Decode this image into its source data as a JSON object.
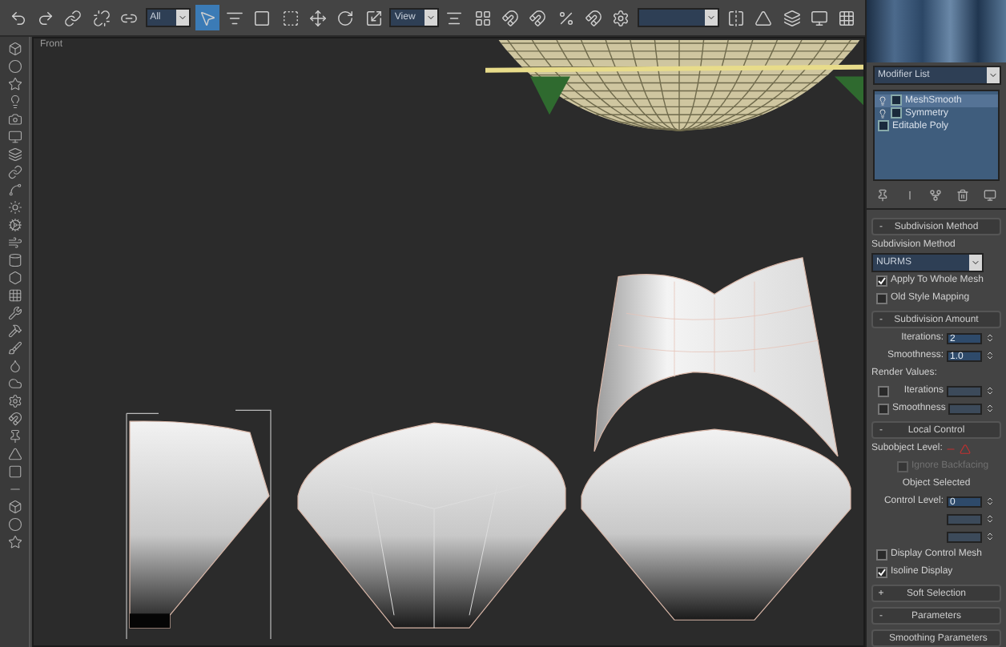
{
  "toolbar": {
    "selection_filter": "All",
    "reference_coordinate": "View"
  },
  "viewport": {
    "label": "Front"
  },
  "modifier_panel": {
    "modifier_list": "Modifier List",
    "stack": [
      {
        "name": "MeshSmooth",
        "kind": "modifier",
        "selected": true
      },
      {
        "name": "Symmetry",
        "kind": "modifier",
        "selected": false
      },
      {
        "name": "Editable Poly",
        "kind": "base",
        "selected": false
      }
    ],
    "rollouts": [
      {
        "title": "Subdivision Method",
        "toggle": "-",
        "rows": [
          {
            "kind": "label",
            "text": "Subdivision Method"
          },
          {
            "kind": "dropdown",
            "value": "NURMS"
          },
          {
            "kind": "checkbox",
            "label": "Apply To Whole Mesh",
            "checked": true,
            "disabled": false
          },
          {
            "kind": "checkbox",
            "label": "Old Style Mapping",
            "checked": false,
            "disabled": false
          }
        ]
      },
      {
        "title": "Subdivision Amount",
        "toggle": "-",
        "rows": [
          {
            "kind": "spinner",
            "label": "Iterations:",
            "value": "2",
            "disabled": false
          },
          {
            "kind": "spinner",
            "label": "Smoothness:",
            "value": "1.0",
            "disabled": false
          },
          {
            "kind": "label",
            "text": "Render Values:"
          },
          {
            "kind": "check_spinner",
            "label": "Iterations",
            "checked": false
          },
          {
            "kind": "check_spinner",
            "label": "Smoothness",
            "checked": false
          }
        ]
      },
      {
        "title": "Local Control",
        "toggle": "-",
        "rows": [
          {
            "kind": "subobject",
            "label": "Subobject Level:"
          },
          {
            "kind": "checkbox",
            "label": "Ignore Backfacing",
            "checked": false,
            "disabled": true
          },
          {
            "kind": "note",
            "text": "Object Selected"
          },
          {
            "kind": "spinner",
            "label": "Control Level:",
            "value": "0",
            "disabled": false
          },
          {
            "kind": "spinner",
            "disabled": true
          },
          {
            "kind": "spinner",
            "disabled": true
          },
          {
            "kind": "checkbox",
            "label": "Display Control Mesh",
            "checked": false,
            "disabled": false
          },
          {
            "kind": "checkbox",
            "label": "Isoline Display",
            "checked": true,
            "disabled": false
          }
        ]
      },
      {
        "title": "Soft Selection",
        "toggle": "+"
      },
      {
        "title": "Parameters",
        "toggle": "-"
      },
      {
        "title": "Smoothing Parameters"
      }
    ]
  }
}
